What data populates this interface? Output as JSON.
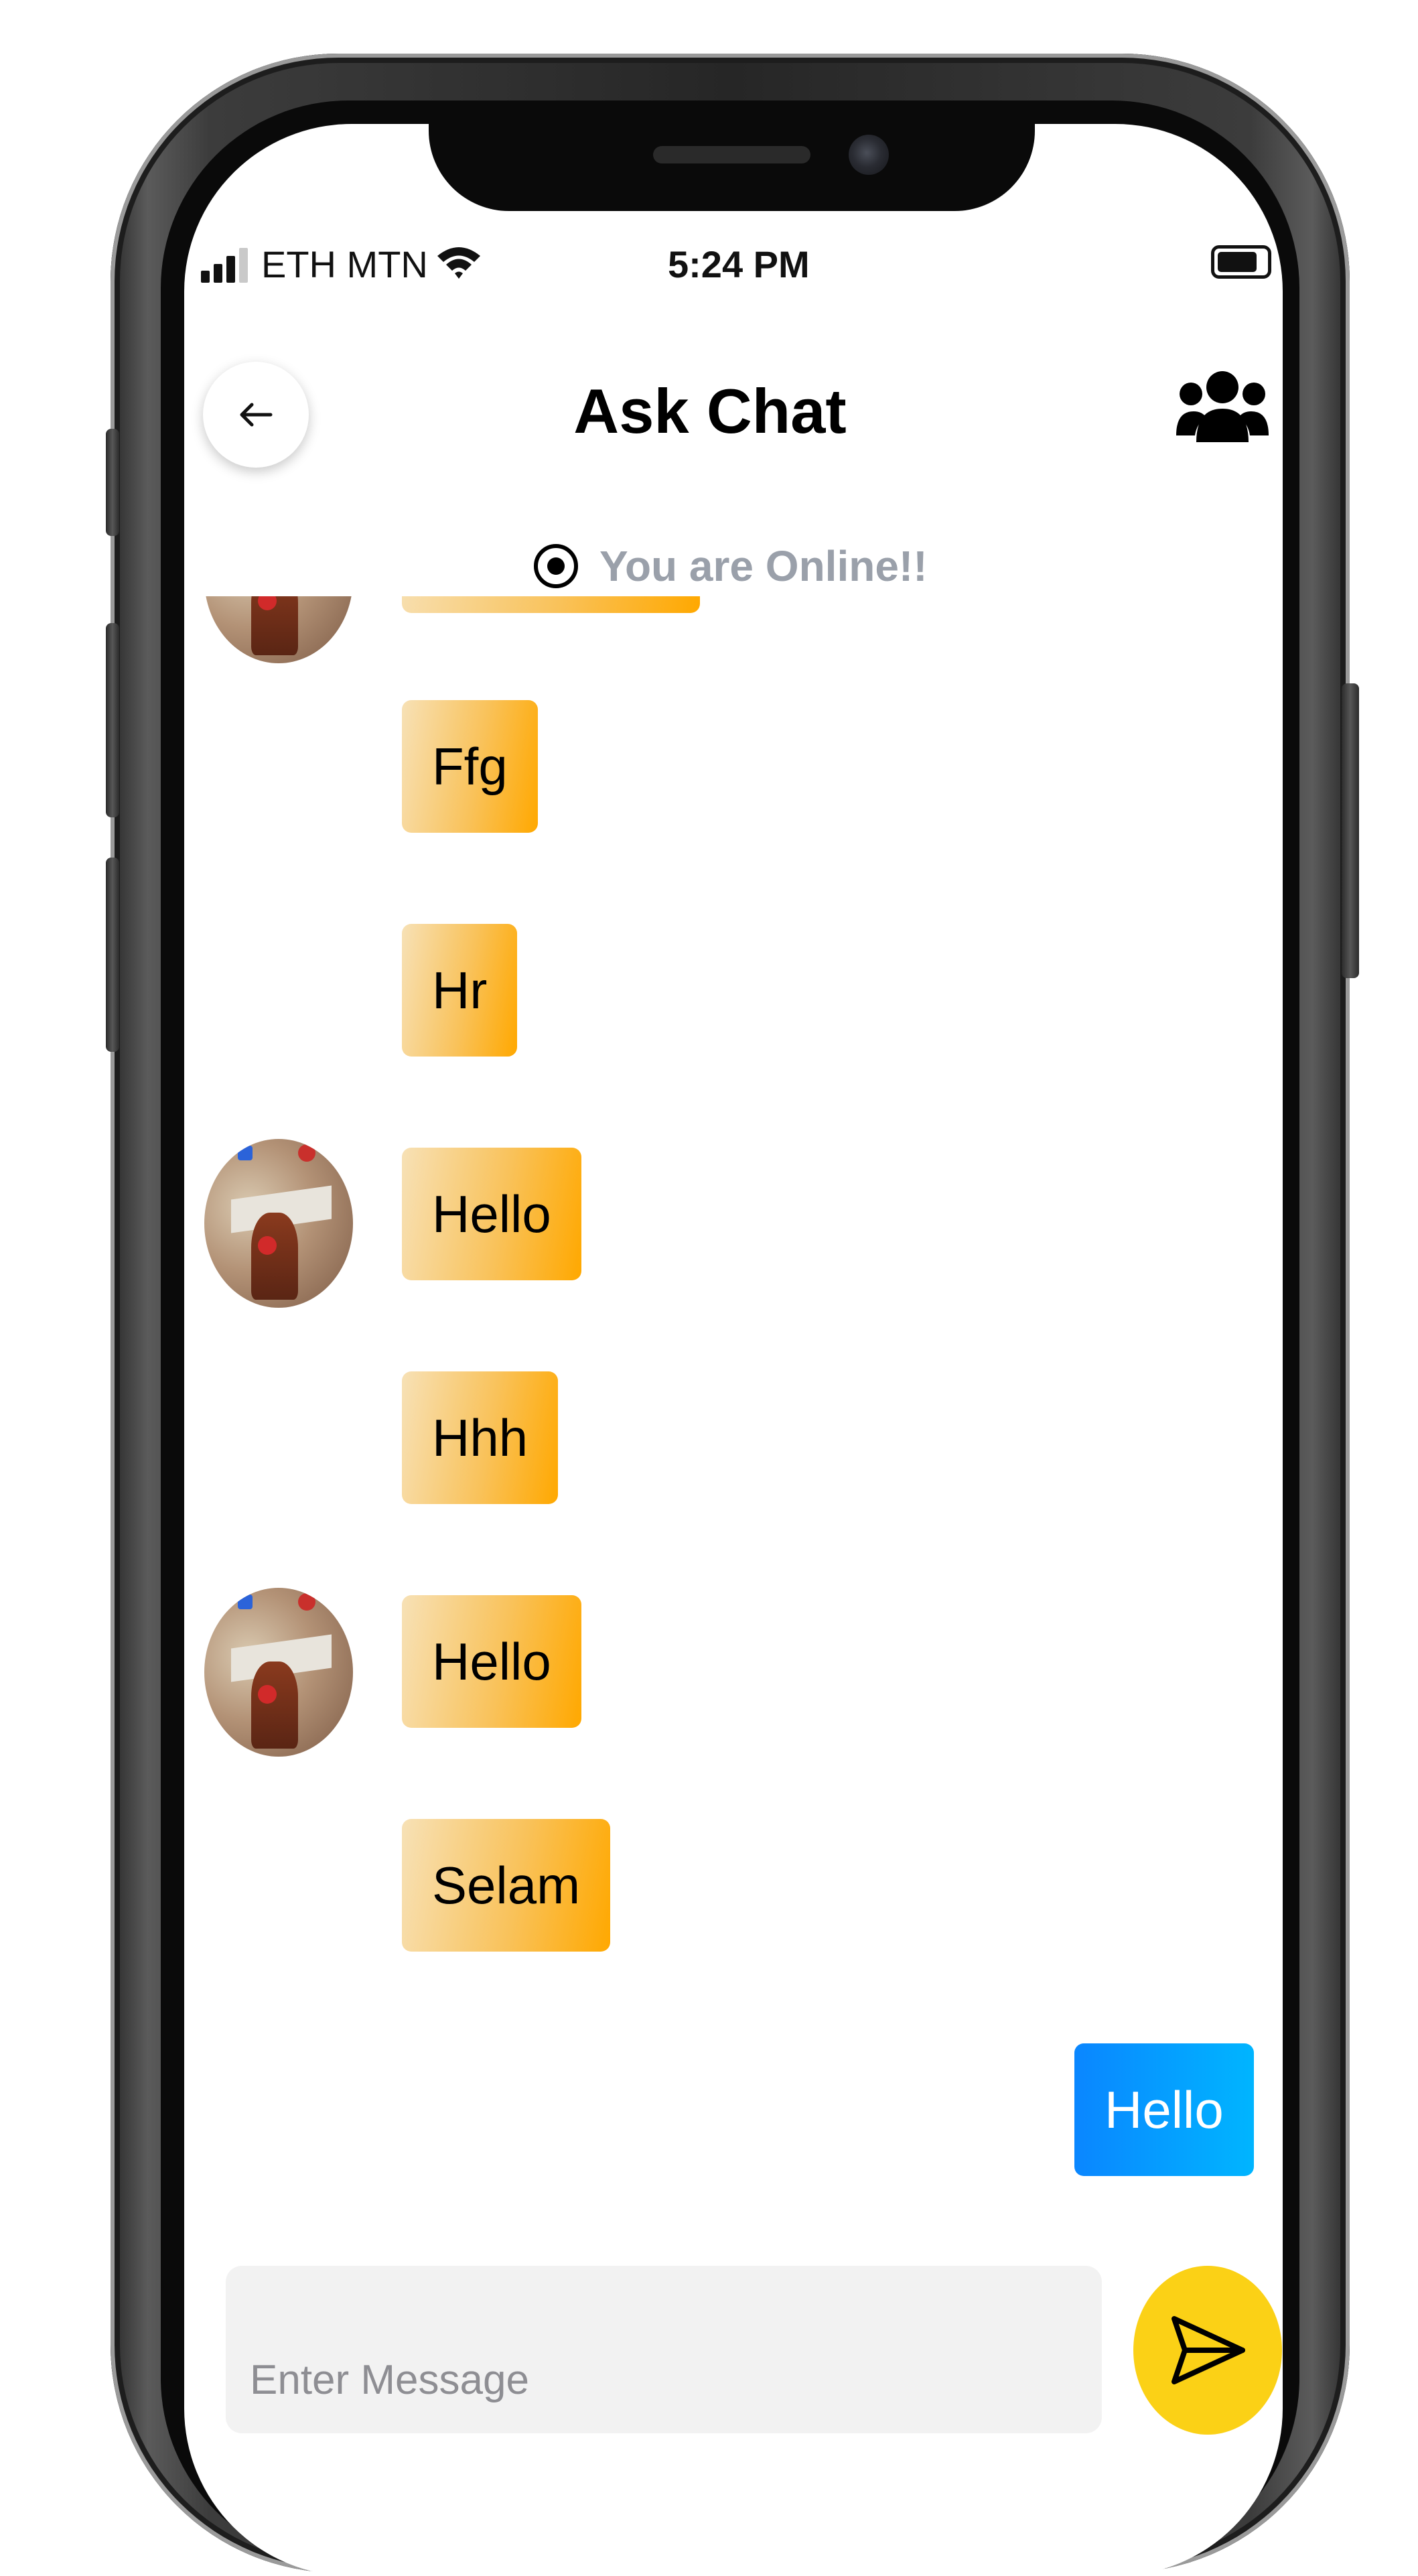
{
  "status_bar": {
    "carrier": "ETH MTN",
    "time": "5:24 PM"
  },
  "header": {
    "title": "Ask Chat",
    "back_icon": "arrow-left-icon",
    "group_icon": "users-icon"
  },
  "presence": {
    "text": "You are Online!!",
    "icon": "radio-dot-icon"
  },
  "messages": [
    {
      "text": "Ffg",
      "side": "incoming"
    },
    {
      "text": "Hr",
      "side": "incoming"
    },
    {
      "text": "Hello",
      "side": "incoming"
    },
    {
      "text": "Hhh",
      "side": "incoming"
    },
    {
      "text": "Hello",
      "side": "incoming"
    },
    {
      "text": "Selam",
      "side": "incoming"
    },
    {
      "text": "Hello",
      "side": "outgoing"
    }
  ],
  "composer": {
    "placeholder": "Enter Message",
    "value": "",
    "send_icon": "send-icon"
  },
  "colors": {
    "incoming_bubble": "#ffa800",
    "outgoing_bubble": "#0a86ff",
    "send_button": "#fbd116",
    "presence_text": "#9aa0aa"
  }
}
